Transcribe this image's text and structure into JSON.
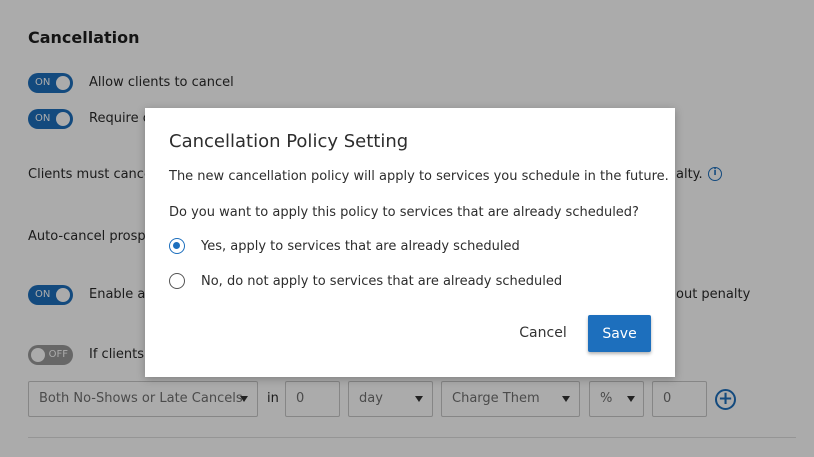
{
  "background": {
    "section_title": "Cancellation",
    "toggle_on_text": "ON",
    "toggle_off_text": "OFF",
    "rows": {
      "allow_cancel": "Allow clients to cancel",
      "require_prefix": "Require c",
      "clients_must_prefix": "Clients must cancel",
      "clients_must_suffix": "alty.",
      "auto_cancel_prefix": "Auto-cancel prospe",
      "enable_prefix": "Enable a",
      "enable_suffix": "out penalty",
      "if_clients_prefix": "If clients w"
    },
    "rule": {
      "type_select": "Both No-Shows or Late Cancels",
      "in_label": "in",
      "count_value": "0",
      "unit_select": "day",
      "action_select": "Charge Them",
      "percent_select": "%",
      "amount_value": "0"
    },
    "info_icon_glyph": "i",
    "add_icon_glyph": "+"
  },
  "modal": {
    "title": "Cancellation Policy Setting",
    "message": "The new cancellation policy will apply to services you schedule in the future.",
    "question": "Do you want to apply this policy to services that are already scheduled?",
    "options": [
      {
        "label": "Yes, apply to services that are already scheduled",
        "selected": true
      },
      {
        "label": "No, do not apply to services that are already scheduled",
        "selected": false
      }
    ],
    "cancel_label": "Cancel",
    "save_label": "Save"
  },
  "colors": {
    "accent": "#1d6fbd",
    "overlay": "rgba(0,0,0,0.33)"
  }
}
